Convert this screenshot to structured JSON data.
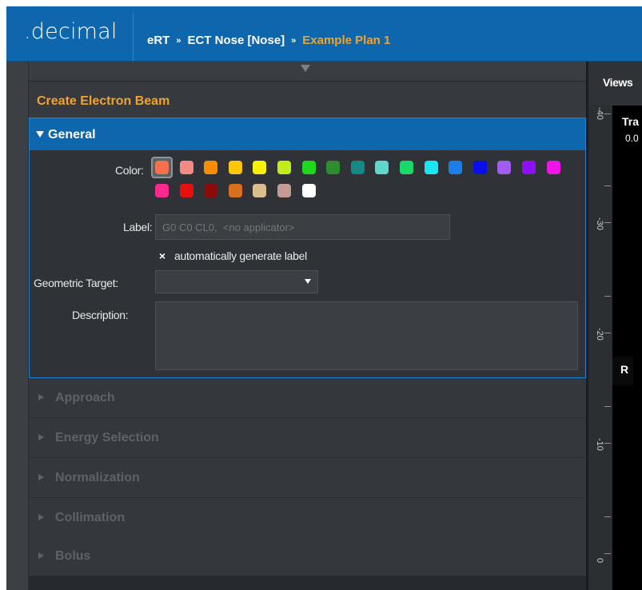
{
  "header": {
    "logo": ".decimal",
    "breadcrumb": {
      "sep": "»",
      "items": [
        "eRT",
        "ECT Nose [Nose]",
        "Example Plan 1"
      ]
    }
  },
  "panel": {
    "title": "Create Electron Beam",
    "general": {
      "heading": "General",
      "color_label": "Color:",
      "colors": [
        "#f86f4d",
        "#f48a80",
        "#fb8c00",
        "#fbc707",
        "#f6f200",
        "#c2ec1a",
        "#1ed81e",
        "#2f8d2f",
        "#158888",
        "#5fd8cc",
        "#1bd968",
        "#18e6f2",
        "#1a7fe8",
        "#0a0ee8",
        "#a25df0",
        "#8f10f2",
        "#ef14e9",
        "#fb2a8c",
        "#e61010",
        "#8b0b0b",
        "#d8701e",
        "#dcbd8e",
        "#c59a94",
        "#ffffff"
      ],
      "selected_color": "#f86f4d",
      "label_label": "Label:",
      "label_placeholder": "G0 C0 CL0,  <no applicator>",
      "auto_label_checkbox": "×",
      "auto_label_text": "automatically generate label",
      "geometric_target_label": "Geometric Target:",
      "geometric_target_value": "",
      "description_label": "Description:",
      "description_value": ""
    },
    "sections": [
      "Approach",
      "Energy Selection",
      "Normalization",
      "Collimation",
      "Bolus"
    ]
  },
  "viewer": {
    "views_label": "Views",
    "title": "Tra",
    "subtitle": "0.0",
    "orientation": "R",
    "ruler_labels": [
      "-40",
      "-30",
      "-20",
      "-10",
      "0"
    ]
  }
}
